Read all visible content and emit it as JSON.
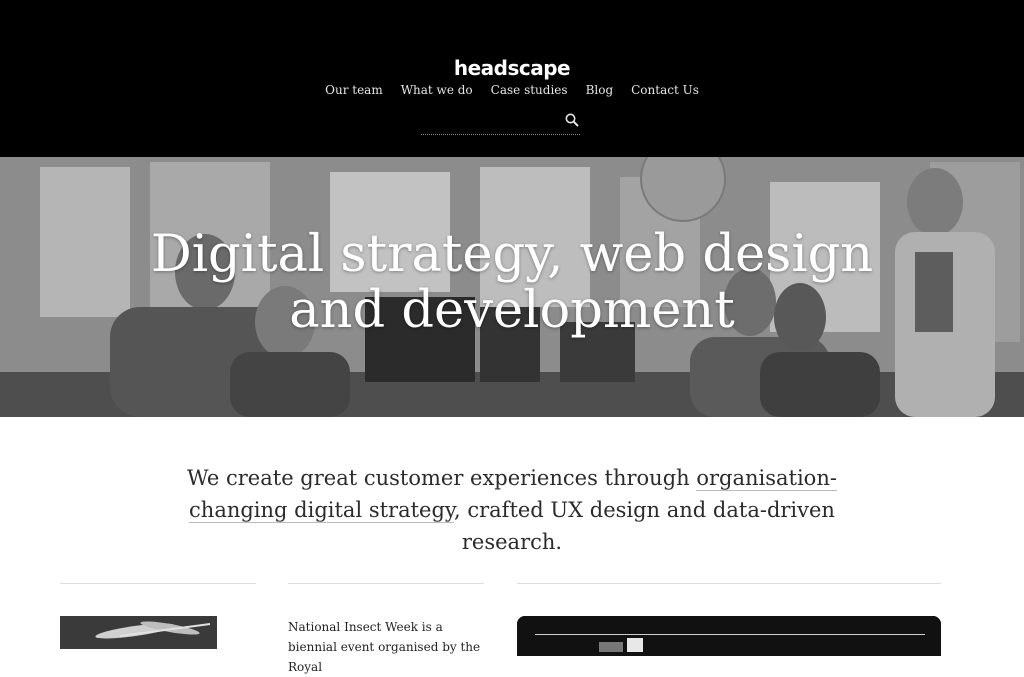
{
  "header": {
    "logo_text": "headscape",
    "nav": [
      "Our team",
      "What we do",
      "Case studies",
      "Blog",
      "Contact Us"
    ],
    "search": {
      "placeholder": "",
      "value": "",
      "icon": "search-icon"
    }
  },
  "hero": {
    "title_line1": "Digital strategy, web design",
    "title_line2": "and development"
  },
  "intro": {
    "before": "We create great customer experiences through ",
    "link": "organisation-changing digital strategy",
    "after": ", crafted UX design and data-driven research."
  },
  "feature": {
    "text": "National Insect Week is a biennial event organised by the Royal"
  },
  "colors": {
    "header_bg": "#000000",
    "accent_text": "#222222"
  }
}
